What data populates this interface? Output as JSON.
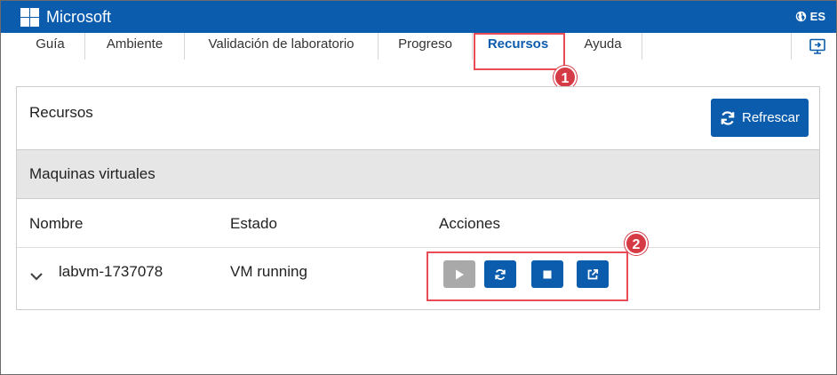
{
  "header": {
    "brand": "Microsoft",
    "language": "ES",
    "accent_color": "#0b5cad"
  },
  "tabs": [
    {
      "label": "Guía",
      "active": false
    },
    {
      "label": "Ambiente",
      "active": false
    },
    {
      "label": "Validación de laboratorio",
      "active": false
    },
    {
      "label": "Progreso",
      "active": false
    },
    {
      "label": "Recursos",
      "active": true
    },
    {
      "label": "Ayuda",
      "active": false
    }
  ],
  "tab_right_icon": "monitor-arrow-icon",
  "annotations": {
    "badge_1": "1",
    "badge_2": "2",
    "highlight_color": "#e94b57"
  },
  "panel": {
    "title": "Recursos",
    "refresh_label": "Refrescar",
    "section_title": "Maquinas virtuales",
    "columns": [
      "Nombre",
      "Estado",
      "Acciones"
    ],
    "rows": [
      {
        "name": "labvm-1737078",
        "status": "VM running"
      }
    ],
    "actions": [
      {
        "icon": "play-icon",
        "enabled": false
      },
      {
        "icon": "refresh-icon",
        "enabled": true
      },
      {
        "icon": "stop-icon",
        "enabled": true
      },
      {
        "icon": "external-link-icon",
        "enabled": true
      }
    ]
  }
}
